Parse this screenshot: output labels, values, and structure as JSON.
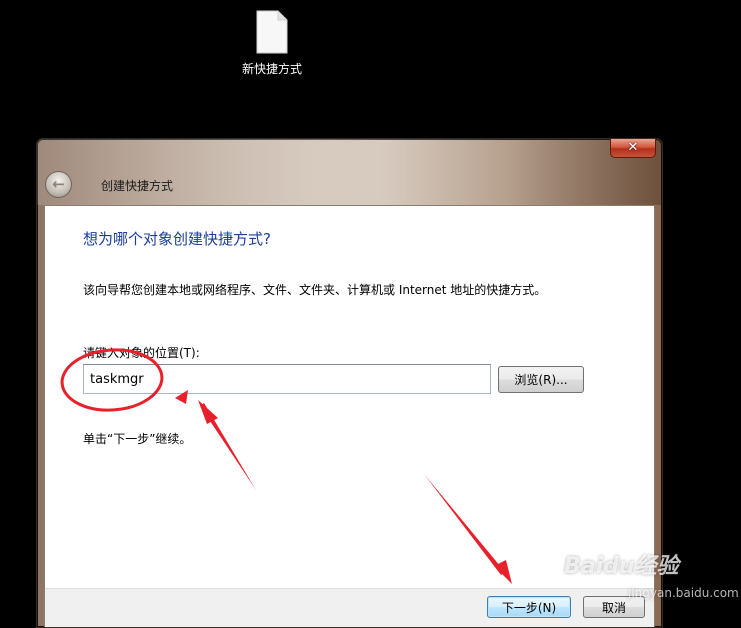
{
  "desktop": {
    "shortcut_label": "新快捷方式"
  },
  "window": {
    "title": "创建快捷方式",
    "close_glyph": "✕",
    "back_glyph": "←"
  },
  "wizard": {
    "heading": "想为哪个对象创建快捷方式?",
    "description": "该向导帮您创建本地或网络程序、文件、文件夹、计算机或 Internet 地址的快捷方式。",
    "location_label": "请键入对象的位置(T):",
    "location_value": "taskmgr",
    "browse_label": "浏览(R)...",
    "hint": "单击“下一步”继续。",
    "next_label": "下一步(N)",
    "cancel_label": "取消"
  },
  "watermark": {
    "text": "Baidu经验",
    "sub": "jingyan.baidu.com"
  },
  "colors": {
    "annotation_red": "#e8202a",
    "heading_blue": "#1a3e9a",
    "desktop_bg": "#000000"
  },
  "icons": [
    "file-icon",
    "back-arrow-icon",
    "close-icon"
  ]
}
